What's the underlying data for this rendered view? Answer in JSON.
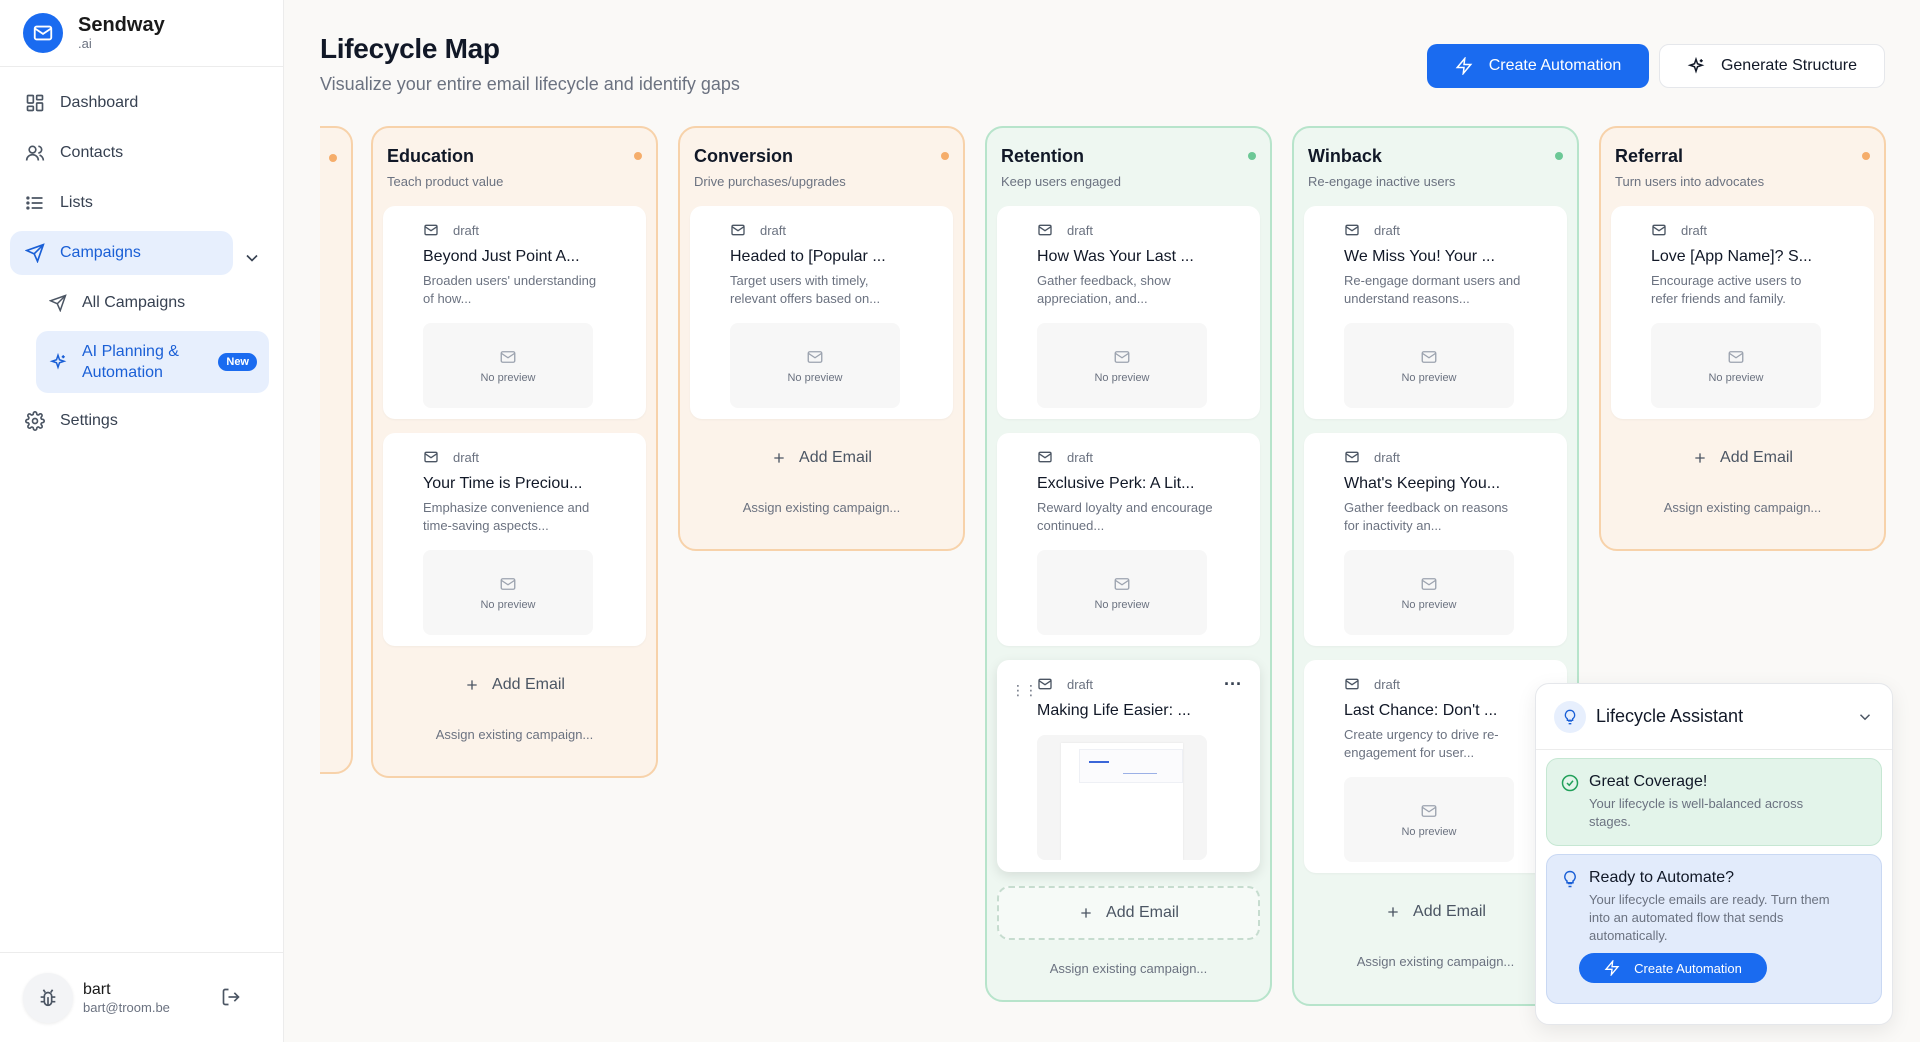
{
  "brand": {
    "name": "Sendway",
    "sub": ".ai"
  },
  "nav": {
    "dashboard": "Dashboard",
    "contacts": "Contacts",
    "lists": "Lists",
    "campaigns": "Campaigns",
    "all_campaigns": "All Campaigns",
    "ai_planning": "AI Planning & Automation",
    "new_badge": "New",
    "settings": "Settings"
  },
  "user": {
    "name": "bart",
    "email": "bart@troom.be"
  },
  "header": {
    "title": "Lifecycle Map",
    "subtitle": "Visualize your entire email lifecycle and identify gaps",
    "create_automation": "Create Automation",
    "generate_structure": "Generate Structure"
  },
  "labels": {
    "draft": "draft",
    "no_preview": "No preview",
    "add_email": "Add Email",
    "assign_existing": "Assign existing campaign..."
  },
  "columns": [
    {
      "title": "Education",
      "desc": "Teach product value",
      "cards": [
        {
          "title": "Beyond Just Point A...",
          "desc": "Broaden users' understanding of how..."
        },
        {
          "title": "Your Time is Preciou...",
          "desc": "Emphasize convenience and time-saving aspects..."
        }
      ]
    },
    {
      "title": "Conversion",
      "desc": "Drive purchases/upgrades",
      "cards": [
        {
          "title": "Headed to [Popular ...",
          "desc": "Target users with timely, relevant offers based on..."
        }
      ]
    },
    {
      "title": "Retention",
      "desc": "Keep users engaged",
      "cards": [
        {
          "title": "How Was Your Last ...",
          "desc": "Gather feedback, show appreciation, and..."
        },
        {
          "title": "Exclusive Perk: A Lit...",
          "desc": "Reward loyalty and encourage continued..."
        },
        {
          "title": "Making Life Easier: ..."
        }
      ]
    },
    {
      "title": "Winback",
      "desc": "Re-engage inactive users",
      "cards": [
        {
          "title": "We Miss You! Your ...",
          "desc": "Re-engage dormant users and understand reasons..."
        },
        {
          "title": "What's Keeping You...",
          "desc": "Gather feedback on reasons for inactivity an..."
        },
        {
          "title": "Last Chance: Don't ...",
          "desc": "Create urgency to drive re-engagement for user..."
        }
      ]
    },
    {
      "title": "Referral",
      "desc": "Turn users into advocates",
      "cards": [
        {
          "title": "Love [App Name]? S...",
          "desc": "Encourage active users to refer friends and family."
        }
      ]
    }
  ],
  "assistant": {
    "title": "Lifecycle Assistant",
    "good_title": "Great Coverage!",
    "good_body": "Your lifecycle is well-balanced across stages.",
    "auto_title": "Ready to Automate?",
    "auto_body": "Your lifecycle emails are ready. Turn them into an automated flow that sends automatically.",
    "auto_button": "Create Automation"
  },
  "colors": {
    "accent": "#1a6bf0",
    "stage_orange": "#f5ad6b",
    "stage_green": "#6cc896"
  }
}
